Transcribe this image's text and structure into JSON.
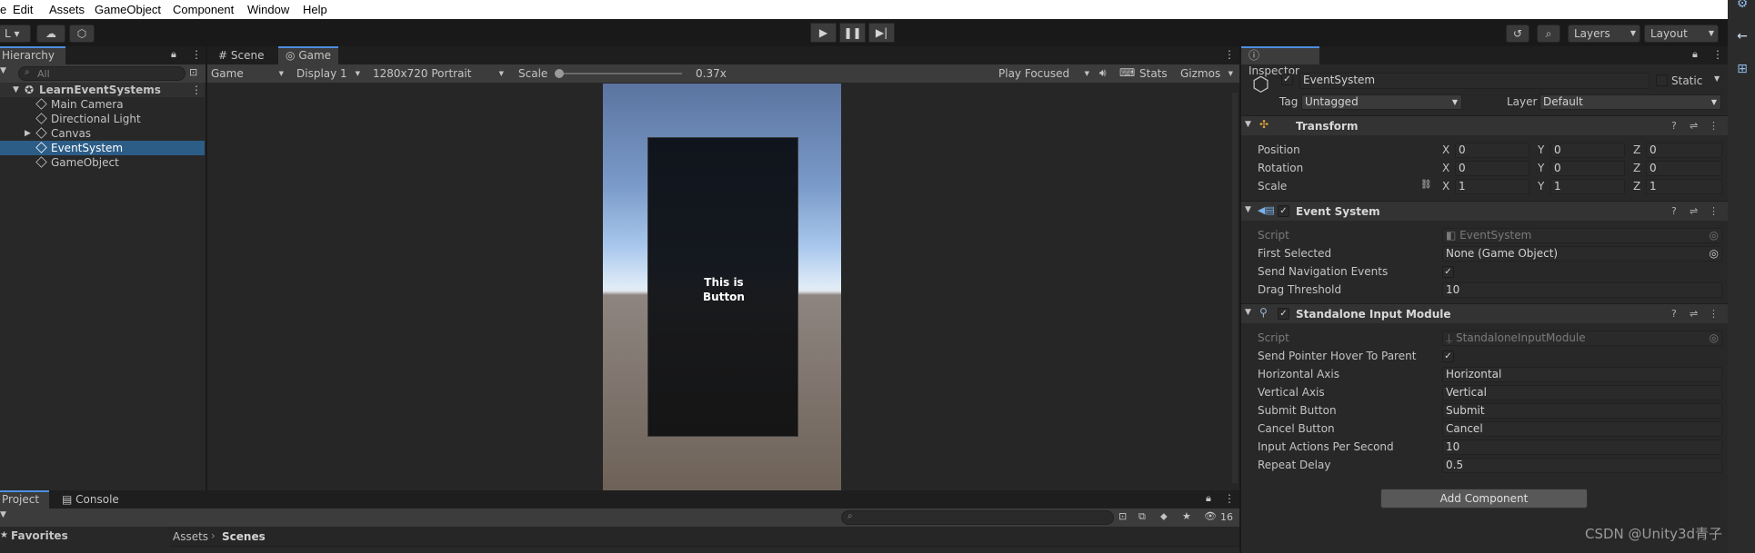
{
  "menu": [
    "e",
    "Edit",
    "Assets",
    "GameObject",
    "Component",
    "Window",
    "Help"
  ],
  "toolbar": {
    "account_label": "L",
    "layers_label": "Layers",
    "layout_label": "Layout"
  },
  "hierarchy": {
    "tab_label": "Hierarchy",
    "search_placeholder": "All",
    "scene_name": "LearnEventSystems",
    "items": [
      {
        "label": "Main Camera"
      },
      {
        "label": "Directional Light"
      },
      {
        "label": "Canvas"
      },
      {
        "label": "EventSystem"
      },
      {
        "label": "GameObject"
      }
    ]
  },
  "center_tabs": {
    "scene": "Scene",
    "game": "Game"
  },
  "game_toolbar": {
    "mode": "Game",
    "display": "Display 1",
    "resolution": "1280x720 Portrait",
    "scale_label": "Scale",
    "scale_value": "0.37x",
    "scale_fraction": 0.0,
    "play_focused": "Play Focused",
    "stats": "Stats",
    "gizmos": "Gizmos"
  },
  "game_view": {
    "button_text_line1": "This is",
    "button_text_line2": "Button"
  },
  "inspector": {
    "tab_label": "Inspector",
    "object_name": "EventSystem",
    "static_label": "Static",
    "tag_label": "Tag",
    "tag_value": "Untagged",
    "layer_label": "Layer",
    "layer_value": "Default",
    "transform": {
      "title": "Transform",
      "rows": [
        {
          "label": "Position",
          "x": "0",
          "y": "0",
          "z": "0"
        },
        {
          "label": "Rotation",
          "x": "0",
          "y": "0",
          "z": "0"
        },
        {
          "label": "Scale",
          "x": "1",
          "y": "1",
          "z": "1"
        }
      ]
    },
    "event_system": {
      "title": "Event System",
      "script_label": "Script",
      "script_value": "EventSystem",
      "first_selected_label": "First Selected",
      "first_selected_value": "None (Game Object)",
      "send_nav_label": "Send Navigation Events",
      "drag_label": "Drag Threshold",
      "drag_value": "10"
    },
    "standalone": {
      "title": "Standalone Input Module",
      "script_label": "Script",
      "script_value": "StandaloneInputModule",
      "hover_label": "Send Pointer Hover To Parent",
      "rows": [
        {
          "label": "Horizontal Axis",
          "value": "Horizontal"
        },
        {
          "label": "Vertical Axis",
          "value": "Vertical"
        },
        {
          "label": "Submit Button",
          "value": "Submit"
        },
        {
          "label": "Cancel Button",
          "value": "Cancel"
        },
        {
          "label": "Input Actions Per Second",
          "value": "10"
        },
        {
          "label": "Repeat Delay",
          "value": "0.5"
        }
      ]
    },
    "add_component": "Add Component",
    "axis_x": "X",
    "axis_y": "Y",
    "axis_z": "Z"
  },
  "project": {
    "tab_project": "Project",
    "tab_console": "Console",
    "favorites": "Favorites",
    "breadcrumb_root": "Assets",
    "breadcrumb_current": "Scenes",
    "hidden_count": "16"
  },
  "watermark": "CSDN @Unity3d青子",
  "colors": {
    "selection": "#2c5d87",
    "accent": "#4d8ee0"
  }
}
